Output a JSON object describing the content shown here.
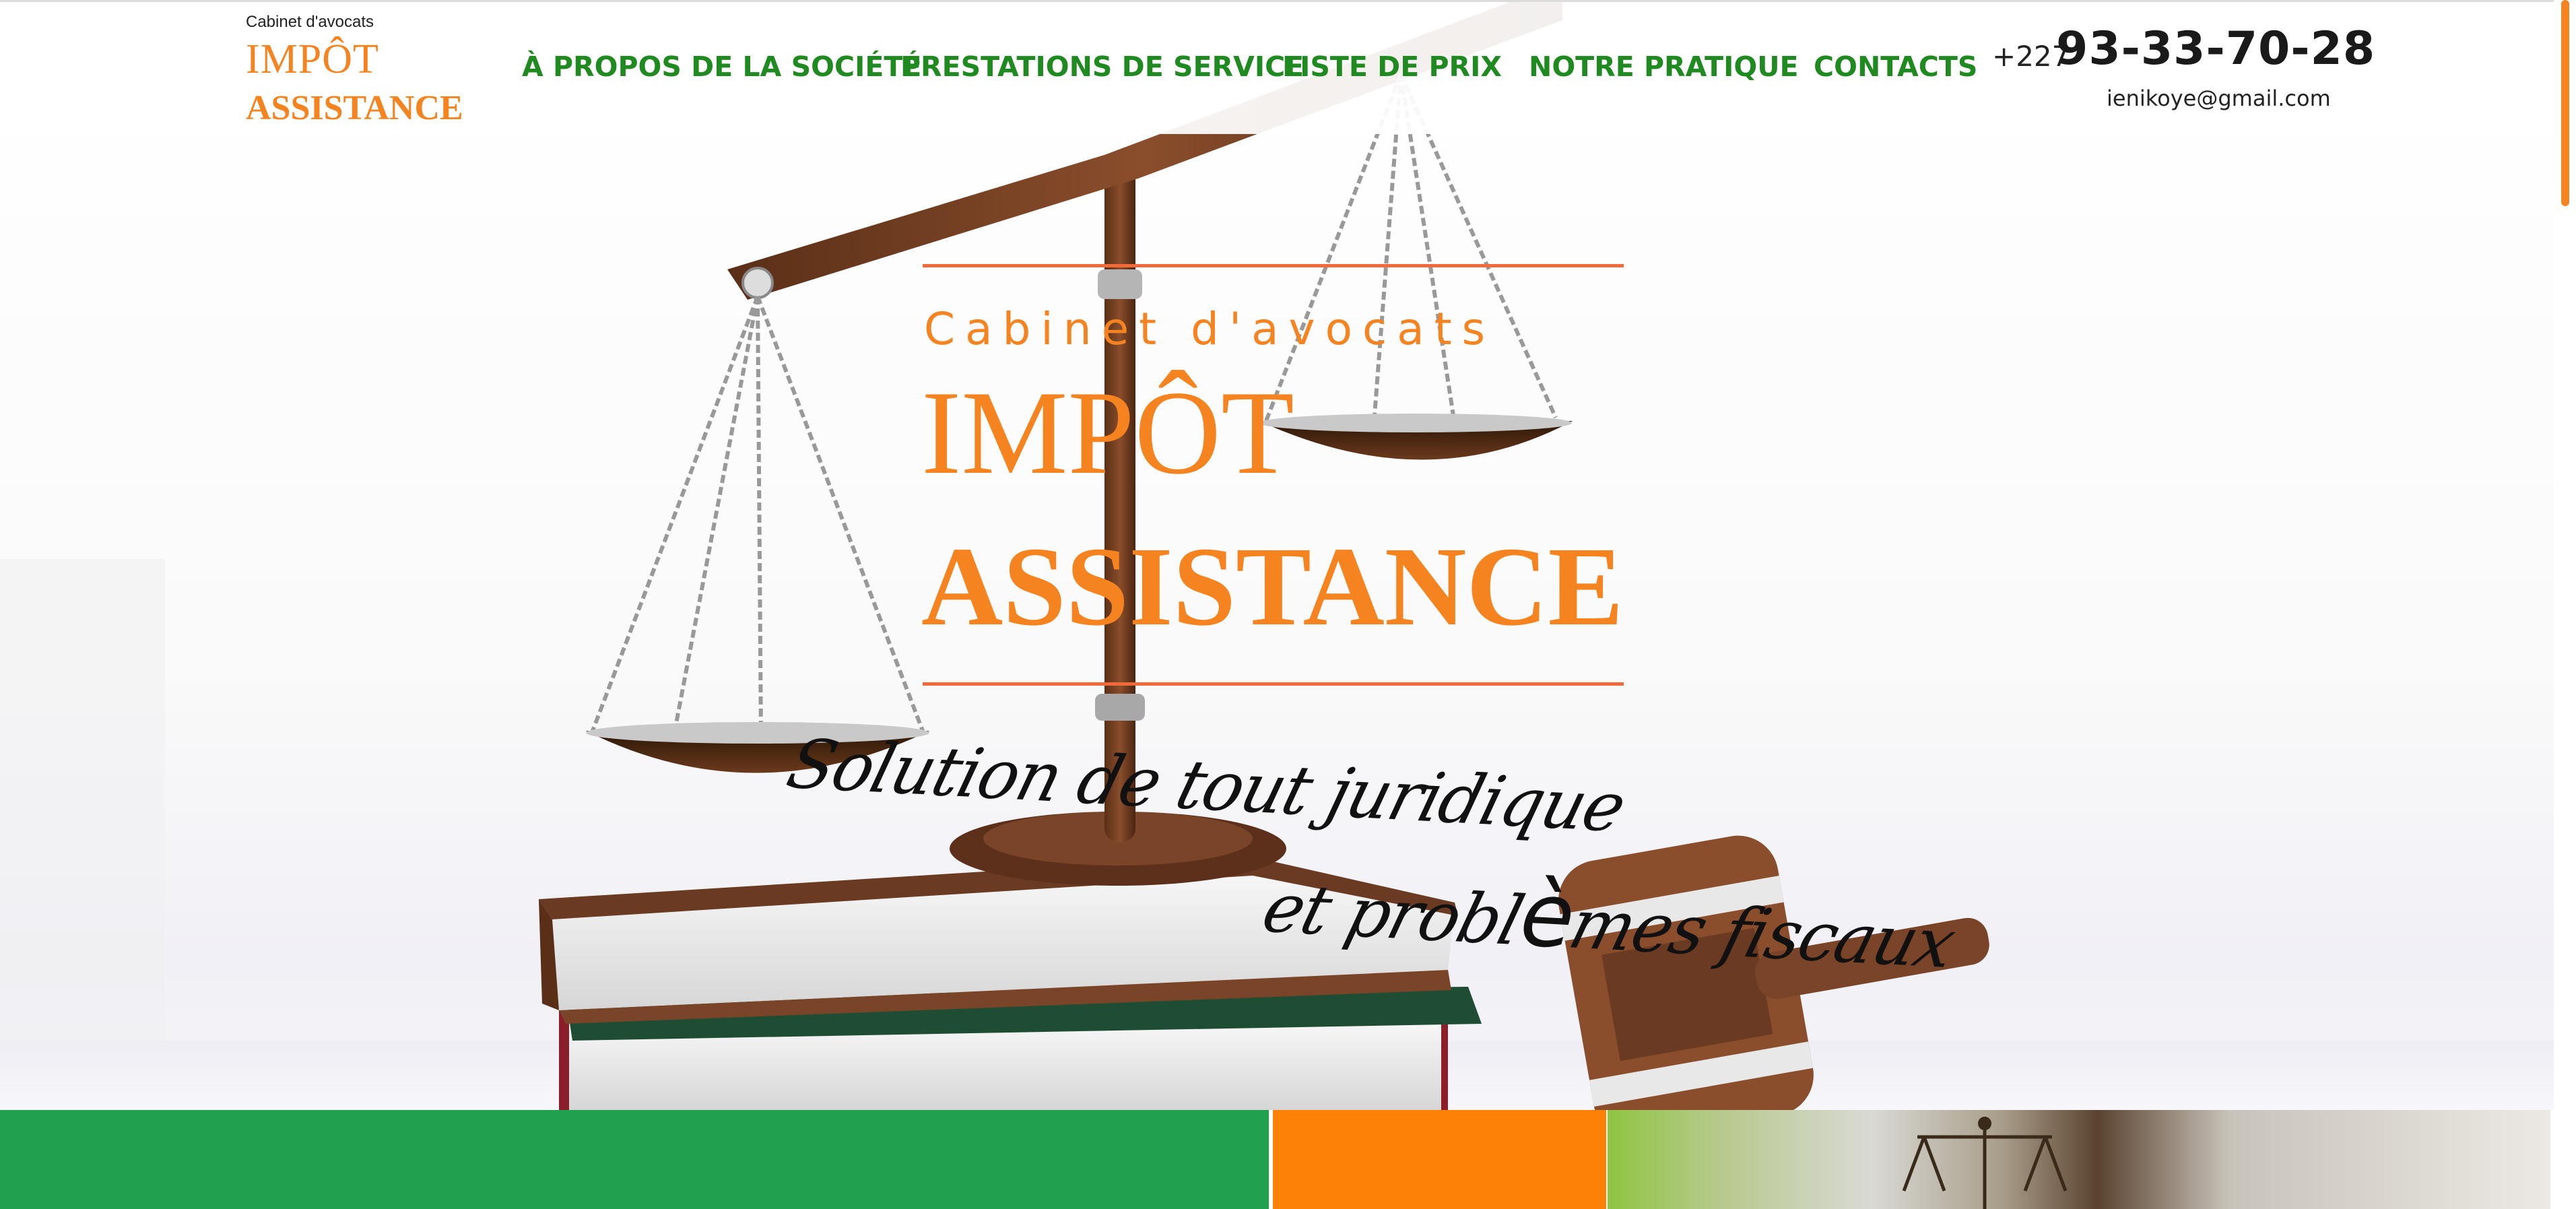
{
  "header": {
    "logo_small": "Cabinet d'avocats",
    "logo_line1": "IMPÔT",
    "logo_line2": "ASSISTANCE",
    "nav": [
      {
        "label": "À PROPOS DE LA SOCIÉTÉ"
      },
      {
        "label": "PRESTATIONS DE SERVICE"
      },
      {
        "label": "LISTE DE PRIX"
      },
      {
        "label": "NOTRE PRATIQUE"
      },
      {
        "label": "CONTACTS"
      }
    ],
    "phone_prefix": "+227",
    "phone_number": "93-33-70-28",
    "email": "ienikoye@gmail.com"
  },
  "hero": {
    "subtitle": "Cabinet d'avocats",
    "title_line1": "IMPÔT",
    "title_line2": "ASSISTANCE",
    "tagline_line1": "Solution de tout juridique",
    "tagline_line2_before": "et probl",
    "tagline_line2_accent": "è",
    "tagline_line2_after": "mes fiscaux"
  },
  "colors": {
    "brand_orange": "#f5831f",
    "nav_green": "#1f8a1f",
    "rule_red": "#f26a3a",
    "panel_green": "#21a14f",
    "panel_orange": "#fd8107"
  }
}
